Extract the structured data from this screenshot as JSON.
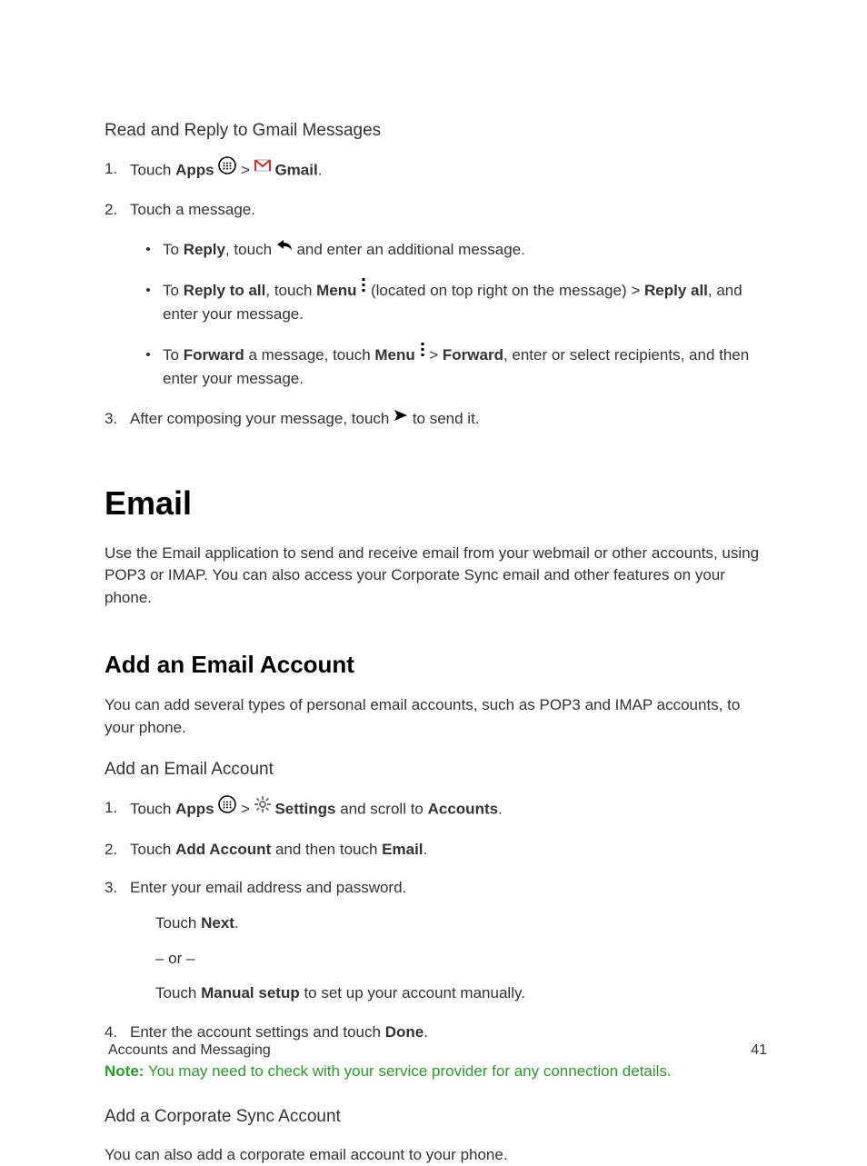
{
  "section1": {
    "heading": "Read and Reply to Gmail Messages",
    "items": [
      {
        "num": "1",
        "pre": "Touch ",
        "b1": "Apps",
        "mid": " > ",
        "b2": "Gmail",
        "post": "."
      },
      {
        "num": "2",
        "text": "Touch a message.",
        "sub": [
          {
            "pre": "To ",
            "b1": "Reply",
            "mid": ", touch ",
            "post": " and enter an additional message."
          },
          {
            "pre": "To ",
            "b1": "Reply to all",
            "mid": ", touch ",
            "b2": "Menu",
            "mid2": " (located on top right on the message) > ",
            "b3": "Reply all",
            "post": ", and enter your message."
          },
          {
            "pre": "To ",
            "b1": "Forward",
            "mid": " a message, touch ",
            "b2": "Menu",
            "mid2": " > ",
            "b3": "Forward",
            "post": ", enter or select recipients, and then enter your message."
          }
        ]
      },
      {
        "num": "3",
        "pre": "After composing your message, touch ",
        "post": " to send it."
      }
    ]
  },
  "email": {
    "h1": "Email",
    "intro": "Use the Email application to send and receive email from your webmail or other accounts, using POP3 or IMAP. You can also access your Corporate Sync email and other features on your phone.",
    "h2": "Add an Email Account",
    "intro2": "You can add several types of personal email accounts, such as POP3 and IMAP accounts, to your phone.",
    "h3": "Add an Email Account",
    "items": [
      {
        "num": "1",
        "pre": "Touch ",
        "b1": "Apps",
        "mid": " > ",
        "b2": "Settings",
        "mid2": " and scroll to ",
        "b3": "Accounts",
        "post": "."
      },
      {
        "num": "2",
        "pre": "Touch ",
        "b1": "Add Account",
        "mid": " and then touch ",
        "b2": "Email",
        "post": "."
      },
      {
        "num": "3",
        "text": "Enter your email address and password.",
        "indent": [
          {
            "pre": "Touch ",
            "b1": "Next",
            "post": "."
          },
          {
            "text": "– or –"
          },
          {
            "pre": "Touch ",
            "b1": "Manual setup",
            "post": " to set up your account manually."
          }
        ]
      },
      {
        "num": "4",
        "pre": "Enter the account settings and touch ",
        "b1": "Done",
        "post": "."
      }
    ],
    "note_label": "Note:",
    "note_text": " You may need to check with your service provider for any connection details.",
    "corp_h3": "Add a Corporate Sync Account",
    "corp_text": "You can also add a corporate email account to your phone."
  },
  "footer": {
    "left": "Accounts and Messaging",
    "right": "41"
  }
}
